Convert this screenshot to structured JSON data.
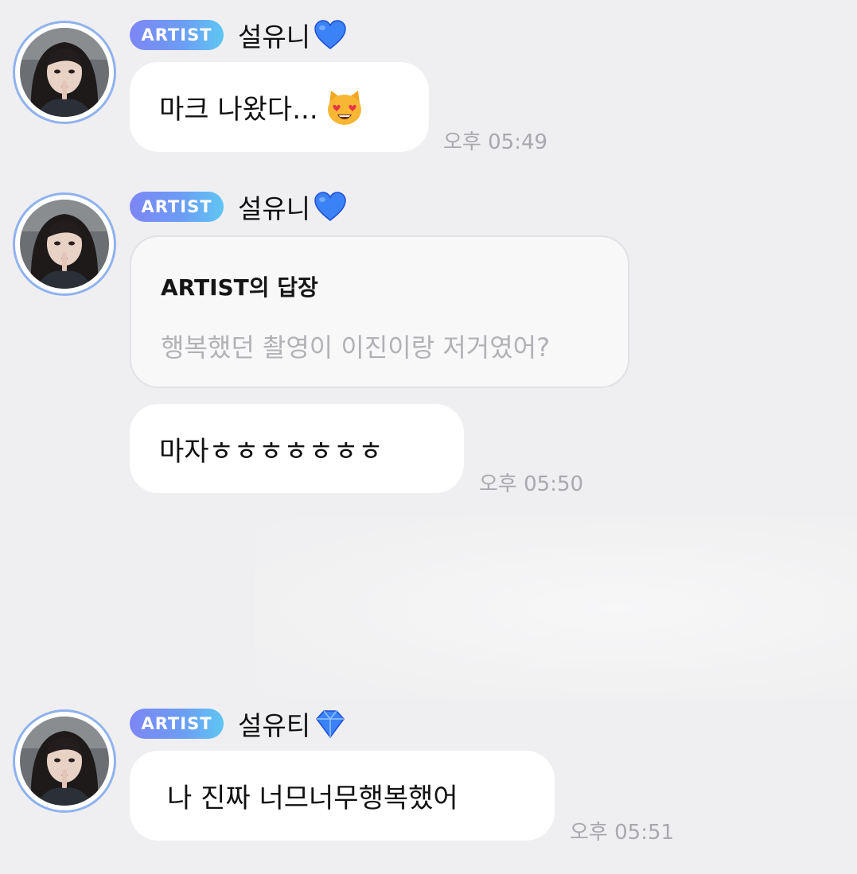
{
  "messages": [
    {
      "badge": "ARTIST",
      "sender": "설유니",
      "heart_icon": "blue-heart-icon",
      "text": "마크 나왔다...",
      "emoji_icon": "heart-eyes-cat-emoji",
      "time": "오후 05:49"
    },
    {
      "badge": "ARTIST",
      "sender": "설유니",
      "heart_icon": "blue-heart-icon",
      "reply": {
        "title": "ARTIST의 답장",
        "quote": "행복했던 촬영이 이진이랑 저거였어?"
      },
      "text": "마자ㅎㅎㅎㅎㅎㅎㅎ",
      "time": "오후 05:50"
    },
    {
      "badge": "ARTIST",
      "sender": "설유티",
      "heart_icon": "blue-diamond-icon",
      "text": "나 진짜 너므너무행복했어",
      "time": "오후 05:51"
    }
  ],
  "colors": {
    "background": "#efeff1",
    "bubble": "#ffffff",
    "badge_gradient_start": "#7d86f5",
    "badge_gradient_end": "#5fc6f3",
    "heart": "#3b82f6",
    "avatar_ring": "#8fb2ee",
    "timestamp": "#a8a8ae",
    "reply_quote": "#b1b1b6"
  }
}
